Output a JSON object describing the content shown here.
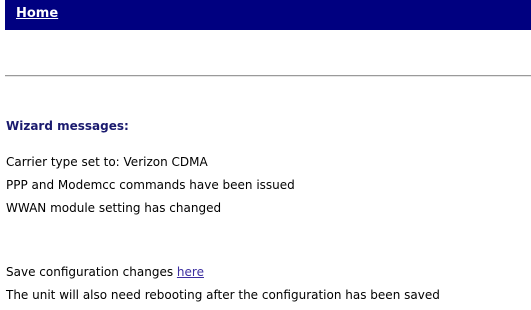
{
  "nav": {
    "home_label": "Home"
  },
  "wizard": {
    "heading": "Wizard messages:",
    "messages": [
      "Carrier type set to: Verizon CDMA",
      "PPP and Modemcc commands have been issued",
      "WWAN module setting has changed"
    ]
  },
  "save": {
    "prefix": "Save configuration changes ",
    "link_label": "here",
    "reboot_note": "The unit will also need rebooting after the configuration has been saved"
  },
  "colors": {
    "header_bar": "#000080",
    "heading_text": "#1a1a6e",
    "link": "#3c2fa0"
  }
}
